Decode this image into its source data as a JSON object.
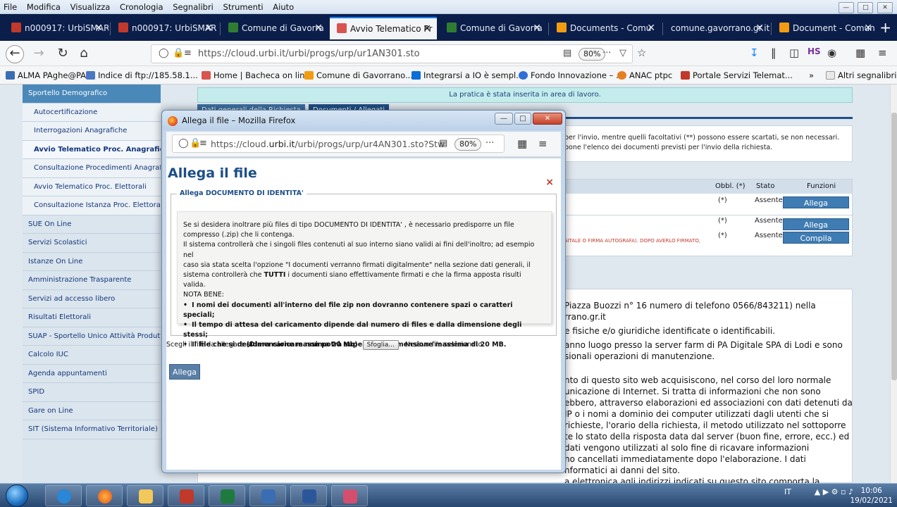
{
  "menubar": {
    "items": [
      "File",
      "Modifica",
      "Visualizza",
      "Cronologia",
      "Segnalibri",
      "Strumenti",
      "Aiuto"
    ]
  },
  "tabs": [
    {
      "label": "n000917: UrbiSMAR",
      "icon": "urbismart-icon"
    },
    {
      "label": "n000917: UrbiSMAR",
      "icon": "urbismart-icon"
    },
    {
      "label": "Comune di Gavorra",
      "icon": "municipality-icon"
    },
    {
      "label": "Avvio Telematico Pr",
      "icon": "urbi-icon"
    },
    {
      "label": "Comune di Gavorra",
      "icon": "municipality-icon"
    },
    {
      "label": "Documents - Comu",
      "icon": "joomla-icon"
    },
    {
      "label": "comune.gavorrano.gr.it",
      "icon": ""
    },
    {
      "label": "Document - Comun",
      "icon": "joomla-icon"
    }
  ],
  "navbar": {
    "url": "https://cloud.urbi.it/urbi/progs/urp/ur1AN301.sto",
    "zoom": "80%",
    "dots": "···"
  },
  "bookmarks": [
    "ALMA PAghe@PA",
    "Indice di ftp://185.58.1...",
    "Home | Bacheca on lin...",
    "Comune di Gavorrano...",
    "Integrarsi a IO è sempl...",
    "Fondo Innovazione – ...",
    "ANAC ptpc",
    "Portale Servizi Telemat...",
    "Altri segnalibri"
  ],
  "sidebar": {
    "items": [
      {
        "label": "Sportello Demografico",
        "kind": "head"
      },
      {
        "label": "Autocertificazione",
        "kind": "sub"
      },
      {
        "label": "Interrogazioni Anagrafiche",
        "kind": "sub"
      },
      {
        "label": "Avvio Telematico Proc. Anagrafici",
        "kind": "sel"
      },
      {
        "label": "Consultazione Procedimenti Anagrafici",
        "kind": "sub"
      },
      {
        "label": "Avvio Telematico Proc. Elettorali",
        "kind": "sub"
      },
      {
        "label": "Consultazione Istanza Proc. Elettorali",
        "kind": "sub"
      },
      {
        "label": "SUE On Line",
        "kind": "item"
      },
      {
        "label": "Servizi Scolastici",
        "kind": "item"
      },
      {
        "label": "Istanze On Line",
        "kind": "item"
      },
      {
        "label": "Amministrazione Trasparente",
        "kind": "item"
      },
      {
        "label": "Servizi ad accesso libero",
        "kind": "item"
      },
      {
        "label": "Risultati Elettorali",
        "kind": "item"
      },
      {
        "label": "SUAP - Sportello Unico Attività Produttive",
        "kind": "item"
      },
      {
        "label": "Calcolo IUC",
        "kind": "item"
      },
      {
        "label": "Agenda appuntamenti",
        "kind": "item"
      },
      {
        "label": "SPID",
        "kind": "item"
      },
      {
        "label": "Gare on Line",
        "kind": "item"
      },
      {
        "label": "SIT (Sistema Informativo Territoriale)",
        "kind": "item"
      }
    ]
  },
  "main": {
    "notice": "La pratica è stata inserita in area di lavoro.",
    "tab1": "Dati generali della Richiesta",
    "tab2": "Documenti / Allegati",
    "info_line1": "per l'invio, mentre quelli facoltativi (**) possono essere scartati, se non necessari.",
    "info_line2": "pone l'elenco dei documenti previsti per l'invio della richiesta.",
    "table": {
      "headers": [
        "Obbl. (*)",
        "Stato",
        "Funzioni"
      ],
      "rows": [
        {
          "obbl": "(*)",
          "stato": "Assente",
          "action": "Allega"
        },
        {
          "obbl": "(*)",
          "stato": "Assente",
          "action": "Allega"
        },
        {
          "obbl": "(*)",
          "stato": "Assente",
          "action": "Compila"
        }
      ]
    },
    "red_note": "GITALE O FIRMA AUTOGRAFA). DOPO AVERLO FIRMATO,",
    "privacy_lines": [
      "Piazza Buozzi n° 16 numero di telefono 0566/843211) nella",
      "rrano.gr.it",
      "e fisiche e/o giuridiche identificate o identificabili.",
      "anno luogo presso la server farm di PA Digitale SPA di Lodi e sono",
      "sionali operazioni di manutenzione.",
      "nto di questo sito web acquisiscono, nel corso del loro normale",
      "unicazione di Internet. Si tratta di informazioni che non sono",
      "ebbero, attraverso elaborazioni ed associazioni con dati detenuti da",
      "IP o i nomi a dominio dei computer utilizzati dagli utenti che si",
      "richieste, l'orario della richiesta, il metodo utilizzato nel sottoporre",
      "te lo stato della risposta data dal server (buon fine, errore, ecc.) ed",
      "dati vengono utilizzati al solo fine di ricavare informazioni",
      "no cancellati immediatamente dopo l'elaborazione. I dati",
      "nformatici ai danni del sito.",
      "a elettronica agli indirizzi indicati su questo sito comporta la",
      "successiva acquisizione dell'indirizzo del mittente, necessario per rispondere alle richieste, nonché degli eventuali altri dati personali inseriti nella missiva o"
    ]
  },
  "popup": {
    "title": "Allega il file – Mozilla Firefox",
    "url_prefix": "https://cloud.",
    "url_domain": "urbi.it",
    "url_suffix": "/urbi/progs/urp/ur4AN301.sto?Stw",
    "zoom": "80%",
    "dots": "···",
    "heading": "Allega il file",
    "close_x": "×",
    "legend": "Allega DOCUMENTO DI IDENTITA'",
    "p1": "Se si desidera inoltrare più files di tipo DOCUMENTO DI IDENTITA' , è necessario predisporre un file",
    "p2": "compresso (.zip) che li contenga.",
    "p3": "Il sistema controllerà che i singoli files contenuti al suo interno siano validi ai fini dell'inoltro; ad esempio nel",
    "p4": "caso sia stata scelta l'opzione \"I documenti verranno firmati digitalmente\" nella sezione dati generali, il",
    "p5a": "sistema controllerà che ",
    "p5b": "TUTTI",
    "p5c": " i documenti siano effettivamente firmati e che la firma apposta risulti valida.",
    "nota": "NOTA BENE:",
    "bullets": [
      "I nomi dei documenti all'interno del file zip non dovranno contenere spazi o caratteri speciali;",
      "Il tempo di attesa del caricamento dipende dal numero di files e dalla dimensione degli stessi;",
      "Il file che si desidera caricare non potrà superare la dimensione massima di 20 MB."
    ],
    "file_label": "Scegli il file da allegare ",
    "file_label_bold": "(Dimensione massima 20 Mb)",
    "browse": "Sfoglia...",
    "no_file": "Nessun file selezionato.",
    "submit": "Allega"
  },
  "taskbar": {
    "lang": "IT",
    "time": "10:06",
    "date": "19/02/2021"
  }
}
